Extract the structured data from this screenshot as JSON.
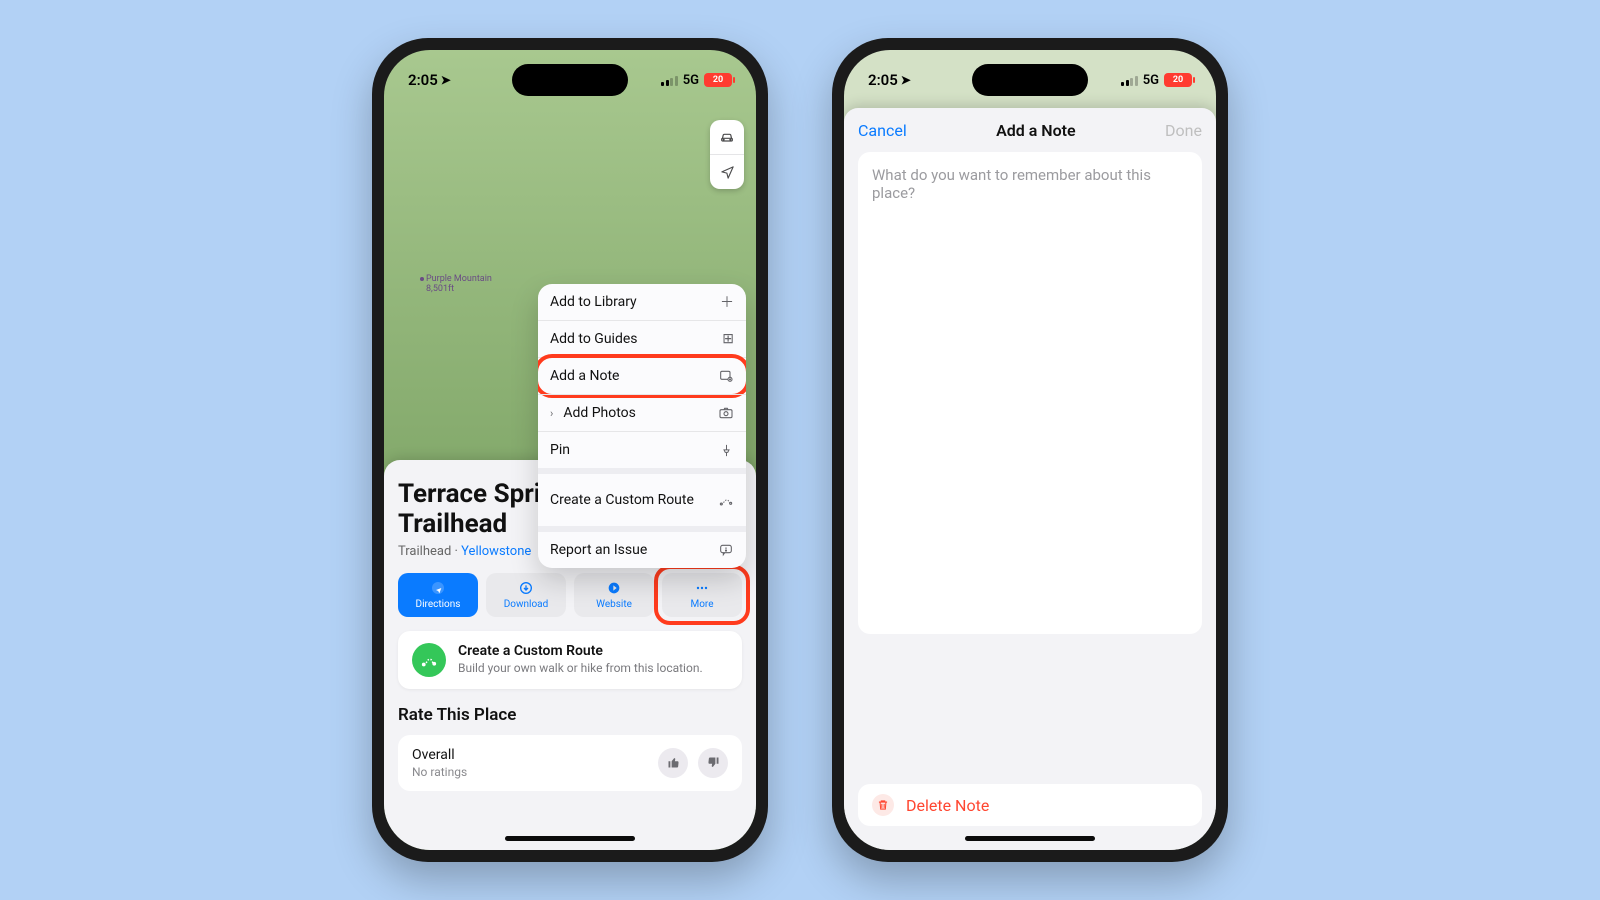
{
  "status": {
    "time": "2:05",
    "network": "5G",
    "battery": "20"
  },
  "map": {
    "poi_name": "Purple Mountain",
    "poi_elev": "8,501ft"
  },
  "place": {
    "title": "Terrace Springs Trailhead",
    "category": "Trailhead",
    "region": "Yellowstone"
  },
  "pills": {
    "directions": "Directions",
    "download": "Download",
    "website": "Website",
    "more": "More"
  },
  "menu": {
    "add_library": "Add to Library",
    "add_guides": "Add to Guides",
    "add_note": "Add a Note",
    "add_photos": "Add Photos",
    "pin": "Pin",
    "custom_route": "Create a Custom Route",
    "report": "Report an Issue"
  },
  "promo": {
    "title": "Create a Custom Route",
    "body": "Build your own walk or hike from this location."
  },
  "rate": {
    "heading": "Rate This Place",
    "overall": "Overall",
    "none": "No ratings"
  },
  "note": {
    "cancel": "Cancel",
    "title": "Add a Note",
    "done": "Done",
    "placeholder": "What do you want to remember about this place?",
    "delete": "Delete Note"
  }
}
